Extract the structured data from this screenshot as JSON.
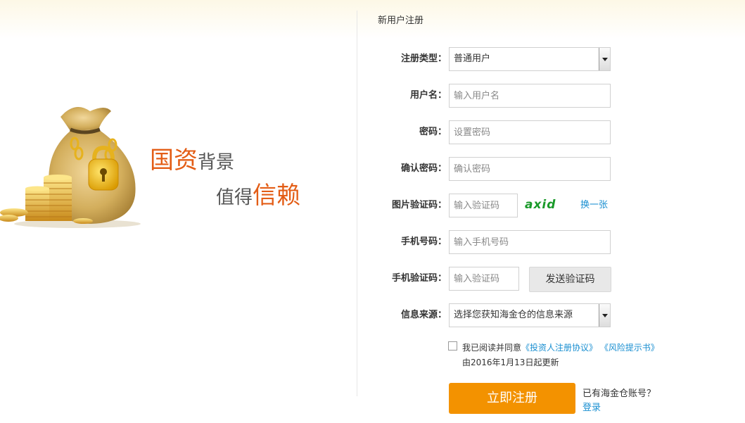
{
  "page": {
    "title": "新用户注册"
  },
  "slogan": {
    "part1_a": "国资",
    "part1_b": "背景",
    "part2_a": "值得",
    "part2_b": "信赖"
  },
  "form": {
    "reg_type": {
      "label": "注册类型：",
      "value": "普通用户"
    },
    "username": {
      "label": "用户名：",
      "placeholder": "输入用户名"
    },
    "password": {
      "label": "密码：",
      "placeholder": "设置密码"
    },
    "confirm_password": {
      "label": "确认密码：",
      "placeholder": "确认密码"
    },
    "image_captcha": {
      "label": "图片验证码：",
      "placeholder": "输入验证码",
      "captcha_text": "axid",
      "refresh_label": "换一张"
    },
    "phone": {
      "label": "手机号码：",
      "placeholder": "输入手机号码"
    },
    "sms_code": {
      "label": "手机验证码：",
      "placeholder": "输入验证码",
      "send_label": "发送验证码"
    },
    "source": {
      "label": "信息来源：",
      "value": "选择您获知海金仓的信息来源"
    }
  },
  "agreement": {
    "prefix": "我已阅读并同意",
    "link1": "《投资人注册协议》",
    "link2": "《风险提示书》",
    "note": "由2016年1月13日起更新",
    "checked": false
  },
  "actions": {
    "submit_label": "立即注册",
    "have_account": "已有海金仓账号？",
    "login_label": "登录"
  },
  "colors": {
    "accent": "#f39200",
    "link": "#1a8fd1",
    "slogan_orange": "#e35d16"
  }
}
